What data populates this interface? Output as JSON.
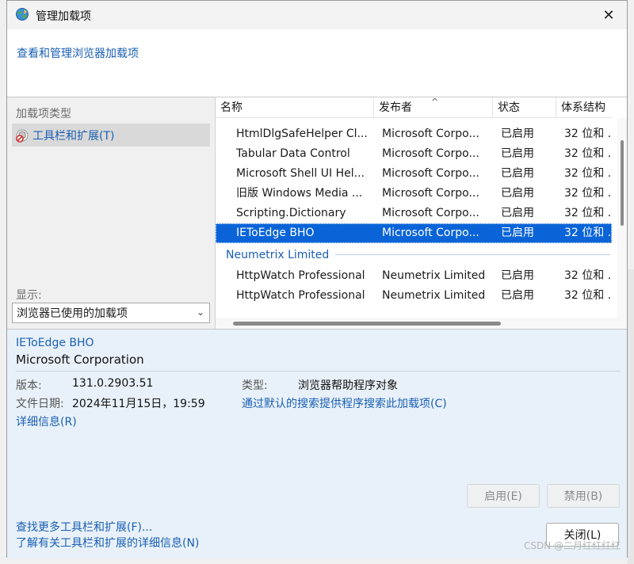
{
  "window": {
    "title": "管理加载项",
    "close_glyph": "✕"
  },
  "header": {
    "link": "查看和管理浏览器加载项"
  },
  "left_pane": {
    "addon_types_label": "加载项类型",
    "types": [
      {
        "label": "工具栏和扩展(T)",
        "icon": "toolbar-extension-icon"
      }
    ],
    "show_label": "显示:",
    "show_select_value": "浏览器已使用的加载项"
  },
  "table": {
    "columns": [
      "名称",
      "发布者",
      "状态",
      "体系结构"
    ],
    "rows": [
      {
        "name": "HtmlDlgSafeHelper Cl...",
        "publisher": "Microsoft Corpo...",
        "status": "已启用",
        "arch": "32 位和 ..."
      },
      {
        "name": "Tabular Data Control",
        "publisher": "Microsoft Corpo...",
        "status": "已启用",
        "arch": "32 位和 ..."
      },
      {
        "name": "Microsoft Shell UI Hel...",
        "publisher": "Microsoft Corpo...",
        "status": "已启用",
        "arch": "32 位和 ..."
      },
      {
        "name": "旧版 Windows Media ...",
        "publisher": "Microsoft Corpo...",
        "status": "已启用",
        "arch": "32 位和 ..."
      },
      {
        "name": "Scripting.Dictionary",
        "publisher": "Microsoft Corpo...",
        "status": "已启用",
        "arch": "32 位和 ..."
      },
      {
        "name": "IEToEdge BHO",
        "publisher": "Microsoft Corpo...",
        "status": "已启用",
        "arch": "32 位和 ..."
      }
    ],
    "group2": {
      "label": "Neumetrix Limited",
      "rows": [
        {
          "name": "HttpWatch Professional",
          "publisher": "Neumetrix Limited",
          "status": "已启用",
          "arch": "32 位和 ..."
        },
        {
          "name": "HttpWatch Professional",
          "publisher": "Neumetrix Limited",
          "status": "已启用",
          "arch": "32 位和 ..."
        }
      ]
    }
  },
  "details": {
    "name": "IEToEdge BHO",
    "company": "Microsoft Corporation",
    "version_label": "版本:",
    "version_value": "131.0.2903.51",
    "date_label": "文件日期:",
    "date_value": "2024年11月15日，19:59",
    "more_info_link": "详细信息(R)",
    "type_label": "类型:",
    "type_value": "浏览器帮助程序对象",
    "search_link": "通过默认的搜索提供程序搜索此加载项(C)",
    "enable_button": "启用(E)",
    "disable_button": "禁用(B)",
    "find_more_link": "查找更多工具栏和扩展(F)...",
    "learn_more_link": "了解有关工具栏和扩展的详细信息(N)",
    "close_button": "关闭(L)"
  },
  "watermark": "CSDN @二月红红红红",
  "colors": {
    "link": "#1a5fb4",
    "selection": "#0a64d8",
    "details_bg": "#e8f1f9"
  }
}
